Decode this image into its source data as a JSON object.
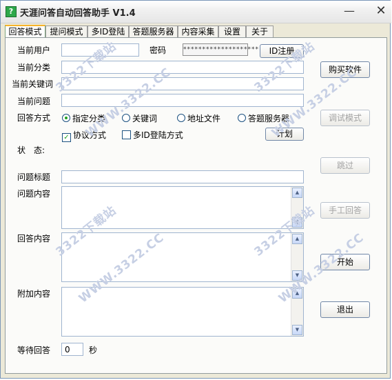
{
  "window": {
    "title": "天涯问答自动回答助手 V1.4",
    "app_icon_glyph": "?",
    "minimize_glyph": "—",
    "close_glyph": "✕"
  },
  "tabs": [
    "回答模式",
    "提问模式",
    "多ID登陆",
    "答题服务器",
    "内容采集",
    "设置",
    "关于"
  ],
  "form": {
    "current_user_label": "当前用户",
    "current_user_value": "",
    "password_label": "密码",
    "password_value": "********************",
    "id_register_button": "ID注册",
    "current_category_label": "当前分类",
    "current_category_value": "",
    "current_keyword_label": "当前关键词",
    "current_keyword_value": "",
    "current_question_label": "当前问题",
    "current_question_value": "",
    "answer_mode_label": "回答方式",
    "answer_modes": [
      {
        "label": "指定分类",
        "selected": true
      },
      {
        "label": "关键词",
        "selected": false
      },
      {
        "label": "地址文件",
        "selected": false
      },
      {
        "label": "答题服务器",
        "selected": false
      }
    ],
    "protocol_mode_label": "协议方式",
    "protocol_mode_checked": true,
    "multi_id_mode_label": "多ID登陆方式",
    "multi_id_mode_checked": false,
    "plan_button": "计划",
    "status_label": "状　态:",
    "question_title_label": "问题标题",
    "question_title_value": "",
    "question_content_label": "问题内容",
    "answer_content_label": "回答内容",
    "extra_content_label": "附加内容",
    "wait_answer_label": "等待回答",
    "wait_answer_value": "0",
    "wait_unit_label": "秒"
  },
  "side_buttons": {
    "buy": "购买软件",
    "debug": "调试模式",
    "skip": "跳过",
    "manual": "手工回答",
    "start": "开始",
    "exit": "退出"
  },
  "watermark": {
    "site": "WWW.3322.CC",
    "brand": "3322下载站"
  }
}
